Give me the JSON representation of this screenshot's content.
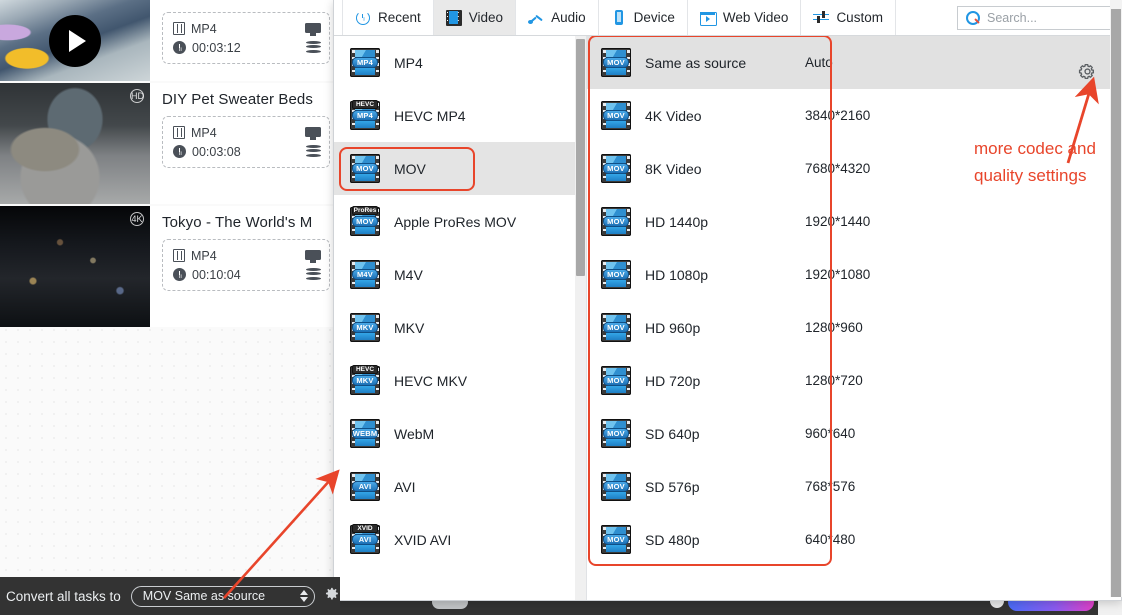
{
  "left_app": {
    "tasks": [
      {
        "title": "",
        "format_label": "MP4",
        "duration": "00:03:12",
        "thumb": "beach-video-thumbnail",
        "has_play_overlay": true,
        "badge": ""
      },
      {
        "title": "DIY Pet Sweater Beds",
        "format_label": "MP4",
        "duration": "00:03:08",
        "thumb": "dog-bed-video-thumbnail",
        "has_play_overlay": false,
        "badge": "HD"
      },
      {
        "title": "Tokyo - The World's M",
        "format_label": "MP4",
        "duration": "00:10:04",
        "thumb": "tokyo-night-video-thumbnail",
        "has_play_overlay": false,
        "badge": "4K"
      }
    ],
    "bottom_bar": {
      "label": "Convert all tasks to",
      "selected_value": "MOV Same as source",
      "gear_icon": "gear-icon",
      "stepper_icon": "stepper-updown-icon"
    }
  },
  "panel": {
    "tabs": [
      {
        "label": "Recent",
        "icon": "recent-clock-icon",
        "active": false
      },
      {
        "label": "Video",
        "icon": "film-strip-icon",
        "active": true
      },
      {
        "label": "Audio",
        "icon": "music-note-icon",
        "active": false
      },
      {
        "label": "Device",
        "icon": "phone-icon",
        "active": false
      },
      {
        "label": "Web Video",
        "icon": "browser-icon",
        "active": false
      },
      {
        "label": "Custom",
        "icon": "sliders-icon",
        "active": false
      }
    ],
    "search": {
      "placeholder": "Search...",
      "value": "",
      "icon": "search-icon"
    },
    "formats": [
      {
        "label": "MP4",
        "badge": "MP4",
        "toptag": "",
        "selected": false
      },
      {
        "label": "HEVC MP4",
        "badge": "MP4",
        "toptag": "HEVC",
        "selected": false
      },
      {
        "label": "MOV",
        "badge": "MOV",
        "toptag": "",
        "selected": true
      },
      {
        "label": "Apple ProRes MOV",
        "badge": "MOV",
        "toptag": "ProRes",
        "selected": false
      },
      {
        "label": "M4V",
        "badge": "M4V",
        "toptag": "",
        "selected": false
      },
      {
        "label": "MKV",
        "badge": "MKV",
        "toptag": "",
        "selected": false
      },
      {
        "label": "HEVC MKV",
        "badge": "MKV",
        "toptag": "HEVC",
        "selected": false
      },
      {
        "label": "WebM",
        "badge": "WEBM",
        "toptag": "",
        "selected": false
      },
      {
        "label": "AVI",
        "badge": "AVI",
        "toptag": "",
        "selected": false
      },
      {
        "label": "XVID AVI",
        "badge": "AVI",
        "toptag": "XVID",
        "selected": false
      }
    ],
    "presets": [
      {
        "name": "Same as source",
        "resolution": "Auto",
        "badge": "MOV",
        "selected": true
      },
      {
        "name": "4K Video",
        "resolution": "3840*2160",
        "badge": "MOV",
        "selected": false
      },
      {
        "name": "8K Video",
        "resolution": "7680*4320",
        "badge": "MOV",
        "selected": false
      },
      {
        "name": "HD 1440p",
        "resolution": "1920*1440",
        "badge": "MOV",
        "selected": false
      },
      {
        "name": "HD 1080p",
        "resolution": "1920*1080",
        "badge": "MOV",
        "selected": false
      },
      {
        "name": "HD 960p",
        "resolution": "1280*960",
        "badge": "MOV",
        "selected": false
      },
      {
        "name": "HD 720p",
        "resolution": "1280*720",
        "badge": "MOV",
        "selected": false
      },
      {
        "name": "SD 640p",
        "resolution": "960*640",
        "badge": "MOV",
        "selected": false
      },
      {
        "name": "SD 576p",
        "resolution": "768*576",
        "badge": "MOV",
        "selected": false
      },
      {
        "name": "SD 480p",
        "resolution": "640*480",
        "badge": "MOV",
        "selected": false
      }
    ],
    "preset_settings_gear": "gear-icon"
  },
  "annotations": {
    "callout_line1": "more codec and",
    "callout_line2": "quality settings",
    "accent_color": "#e8452b"
  }
}
